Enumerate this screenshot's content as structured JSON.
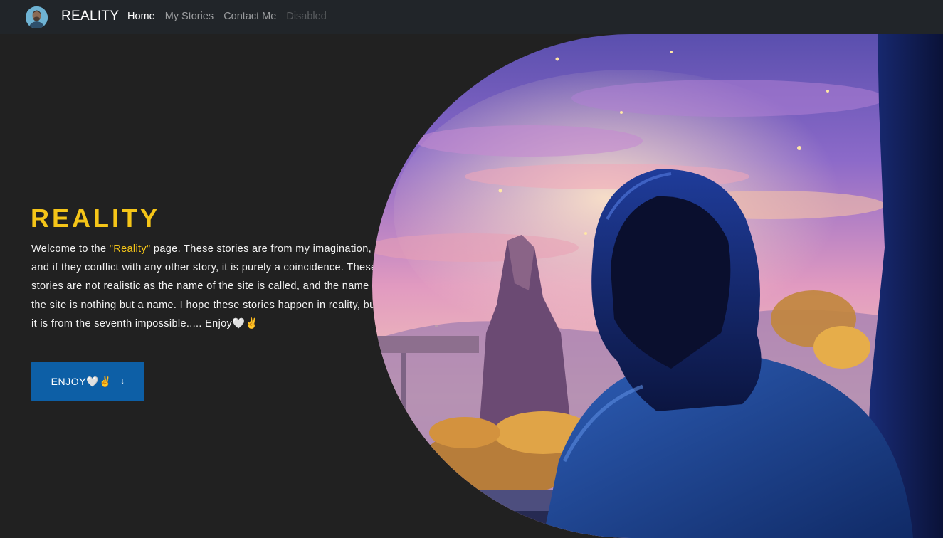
{
  "navbar": {
    "brand": "REALITY",
    "links": [
      {
        "label": "Home",
        "state": "active"
      },
      {
        "label": "My Stories",
        "state": "normal"
      },
      {
        "label": "Contact Me",
        "state": "normal"
      },
      {
        "label": "Disabled",
        "state": "disabled"
      }
    ]
  },
  "hero": {
    "title": "REALITY",
    "text_before": "Welcome to the ",
    "text_highlight": "\"Reality\"",
    "text_after": " page. These stories are from my imagination, and if they conflict with any other story, it is purely a coincidence. These stories are not realistic as the name of the site is called, and the name of the site is nothing but a name. I hope these stories happen in reality, but it is from the seventh impossible..... Enjoy🤍✌️",
    "button_label": "ENJOY🤍✌️",
    "button_icon": "arrow-down-icon",
    "button_arrow": "↓"
  },
  "colors": {
    "background": "#212121",
    "navbar": "#212529",
    "accent": "#f5c518",
    "button": "#0d5fa6"
  }
}
